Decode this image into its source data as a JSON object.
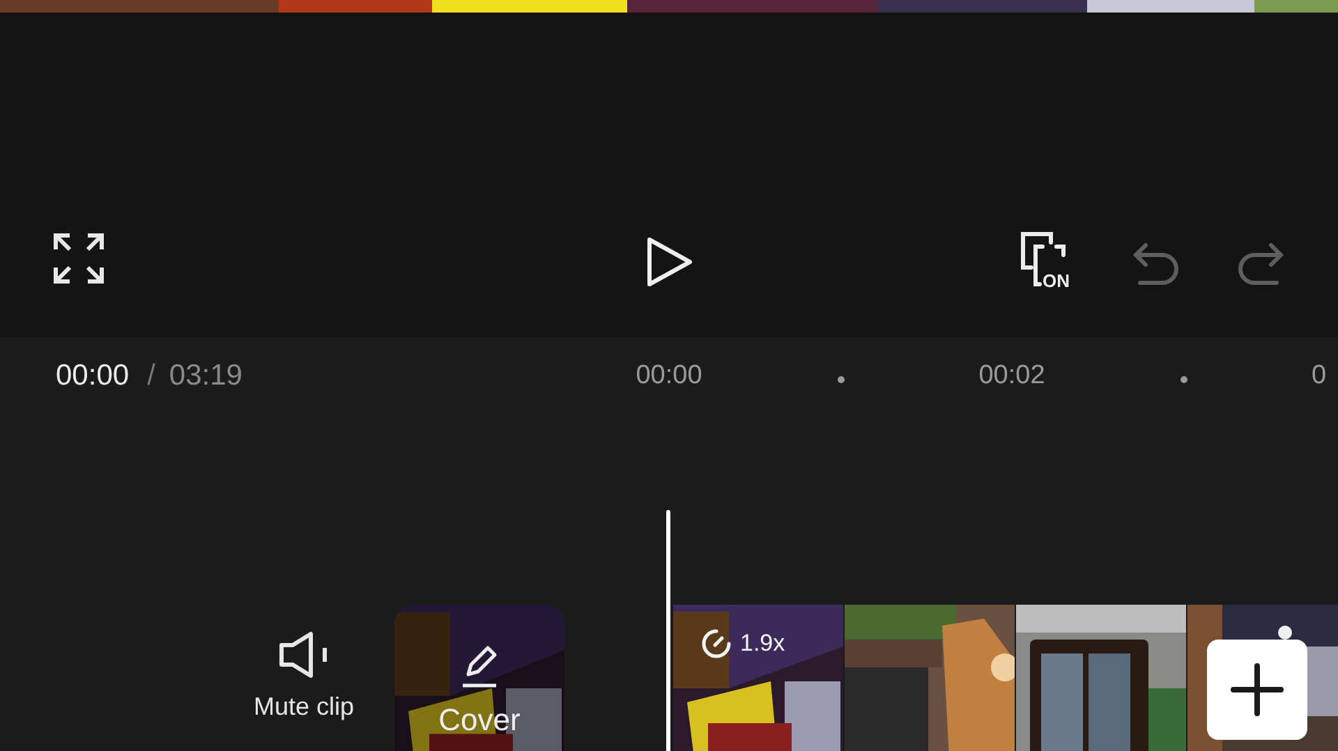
{
  "toolbar": {
    "compare_toggle": {
      "label": "ON",
      "on": true
    },
    "undo": {
      "disabled": true
    },
    "redo": {
      "disabled": true
    }
  },
  "time": {
    "current": "00:00",
    "separator": "/",
    "total": "03:19"
  },
  "ruler": [
    "00:00",
    "00:02",
    "0"
  ],
  "track": {
    "mute": {
      "label": "Mute clip"
    },
    "cover": {
      "label": "Cover"
    },
    "clips": [
      {
        "speed": "1.9x"
      }
    ]
  }
}
